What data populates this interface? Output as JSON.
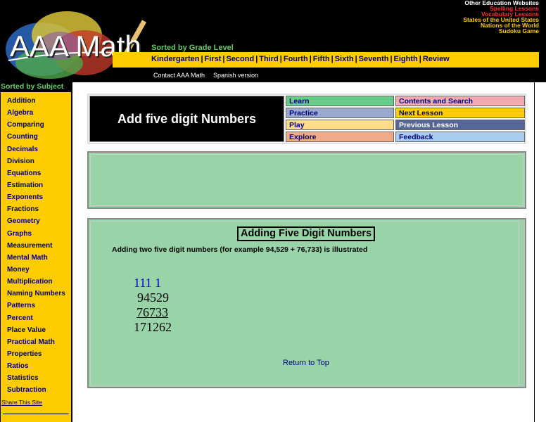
{
  "logo": {
    "text": "AAA Math"
  },
  "other_sites": [
    {
      "label": "Other Education Websites",
      "color": "#ffffff"
    },
    {
      "label": "Spelling Lessons",
      "color": "#ff3333"
    },
    {
      "label": "Vocabulary Lessons",
      "color": "#ff3333"
    },
    {
      "label": "States of the United States",
      "color": "#ffcc00"
    },
    {
      "label": "Nations of the World",
      "color": "#ffcc00"
    },
    {
      "label": "Sudoku Game",
      "color": "#ffcc00"
    }
  ],
  "grade": {
    "title": "Sorted by Grade Level",
    "links": [
      "Kindergarten",
      "First",
      "Second",
      "Third",
      "Fourth",
      "Fifth",
      "Sixth",
      "Seventh",
      "Eighth",
      "Review"
    ]
  },
  "header_links": {
    "contact": "Contact AAA Math",
    "spanish": "Spanish version"
  },
  "sidebar": {
    "title": "Sorted by Subject",
    "items": [
      "Addition",
      "Algebra",
      "Comparing",
      "Counting",
      "Decimals",
      "Division",
      "Equations",
      "Estimation",
      "Exponents",
      "Fractions",
      "Geometry",
      "Graphs",
      "Measurement",
      "Mental Math",
      "Money",
      "Multiplication",
      "Naming Numbers",
      "Patterns",
      "Percent",
      "Place Value",
      "Practical Math",
      "Properties",
      "Ratios",
      "Statistics",
      "Subtraction"
    ],
    "share": "Share This Site"
  },
  "nav": {
    "title": "Add five digit Numbers",
    "learn": "Learn",
    "practice": "Practice",
    "play": "Play",
    "explore": "Explore",
    "contents": "Contents and Search",
    "next": "Next Lesson",
    "previous": "Previous Lesson",
    "feedback": "Feedback"
  },
  "colors": {
    "learn_bg": "#66cc88",
    "practice_bg": "#99aacc",
    "play_bg": "#ffdd88",
    "explore_bg": "#f0aa88",
    "contents_bg": "#f0aab0",
    "next_bg": "#ffcc00",
    "previous_bg": "#556699",
    "feedback_bg": "#aaccee"
  },
  "lesson": {
    "heading": "Adding Five Digit Numbers",
    "description": "Adding two five digit numbers (for example 94,529 + 76,733) is illustrated",
    "carry": "111 1",
    "number1": "94529",
    "number2": "76733",
    "sum": "171262",
    "return_top": "Return to Top"
  }
}
